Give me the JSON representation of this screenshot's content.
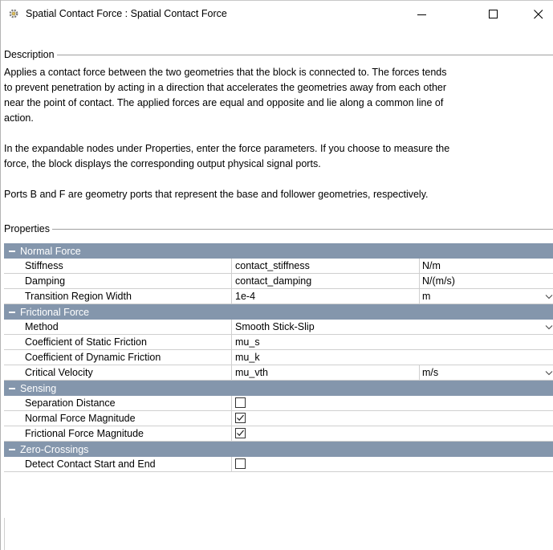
{
  "window": {
    "title": "Spatial Contact Force : Spatial Contact Force",
    "icon": "gear-icon",
    "controls": [
      "minimize",
      "maximize",
      "close"
    ]
  },
  "description": {
    "header": "Description",
    "lines": [
      "Applies a contact force between the two geometries that the block is connected to. The forces tends",
      "to prevent penetration by acting in a direction that accelerates the geometries away from each other",
      "near the point of contact.  The applied forces are equal and opposite and lie along a common line of",
      "action.",
      "In the expandable nodes under Properties, enter the force parameters. If you choose to measure the",
      "force, the block displays the corresponding output physical signal ports.",
      "Ports B and F are geometry ports that represent the base and follower geometries, respectively."
    ]
  },
  "properties": {
    "header": "Properties",
    "sections": [
      {
        "label": "Normal Force",
        "rows": [
          {
            "name": "Stiffness",
            "value": "contact_stiffness",
            "unit": "N/m",
            "unit_dropdown": false
          },
          {
            "name": "Damping",
            "value": "contact_damping",
            "unit": "N/(m/s)",
            "unit_dropdown": false
          },
          {
            "name": "Transition Region Width",
            "value": "1e-4",
            "unit": "m",
            "unit_dropdown": true
          }
        ]
      },
      {
        "label": "Frictional Force",
        "rows": [
          {
            "name": "Method",
            "value": "Smooth Stick-Slip",
            "dropdown": true
          },
          {
            "name": "Coefficient of Static Friction",
            "value": "mu_s"
          },
          {
            "name": "Coefficient of Dynamic Friction",
            "value": "mu_k"
          },
          {
            "name": "Critical Velocity",
            "value": "mu_vth",
            "unit": "m/s",
            "unit_dropdown": true
          }
        ]
      },
      {
        "label": "Sensing",
        "rows": [
          {
            "name": "Separation Distance",
            "checked": false
          },
          {
            "name": "Normal Force Magnitude",
            "checked": true
          },
          {
            "name": "Frictional Force Magnitude",
            "checked": true
          }
        ]
      },
      {
        "label": "Zero-Crossings",
        "rows": [
          {
            "name": "Detect Contact Start and End",
            "checked": false
          }
        ]
      }
    ]
  },
  "colors": {
    "section_header_bg": "#8496ac",
    "grid_line": "#cfcfcf"
  }
}
